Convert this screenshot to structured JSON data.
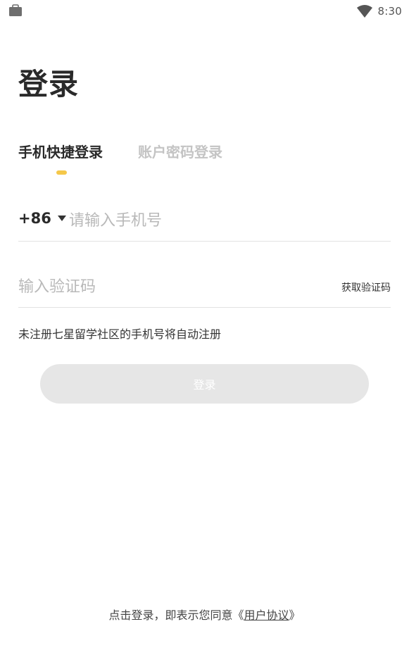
{
  "status_bar": {
    "time": "8:30",
    "left_icon": "bag-icon",
    "right_icon": "wifi-icon"
  },
  "page_title": "登录",
  "tabs": [
    {
      "label": "手机快捷登录",
      "active": true
    },
    {
      "label": "账户密码登录",
      "active": false
    }
  ],
  "phone": {
    "country_code": "+86",
    "placeholder": "请输入手机号",
    "value": ""
  },
  "verification": {
    "placeholder": "输入验证码",
    "value": "",
    "get_code_label": "获取验证码"
  },
  "register_hint": "未注册七星留学社区的手机号将自动注册",
  "login_button_label": "登录",
  "agreement": {
    "prefix": "点击登录，即表示您同意《",
    "link_label": "用户协议",
    "suffix": "》"
  },
  "colors": {
    "accent": "#f5c84a",
    "disabled_button": "#e6e6e6",
    "inactive_tab": "#c4c4c4"
  }
}
